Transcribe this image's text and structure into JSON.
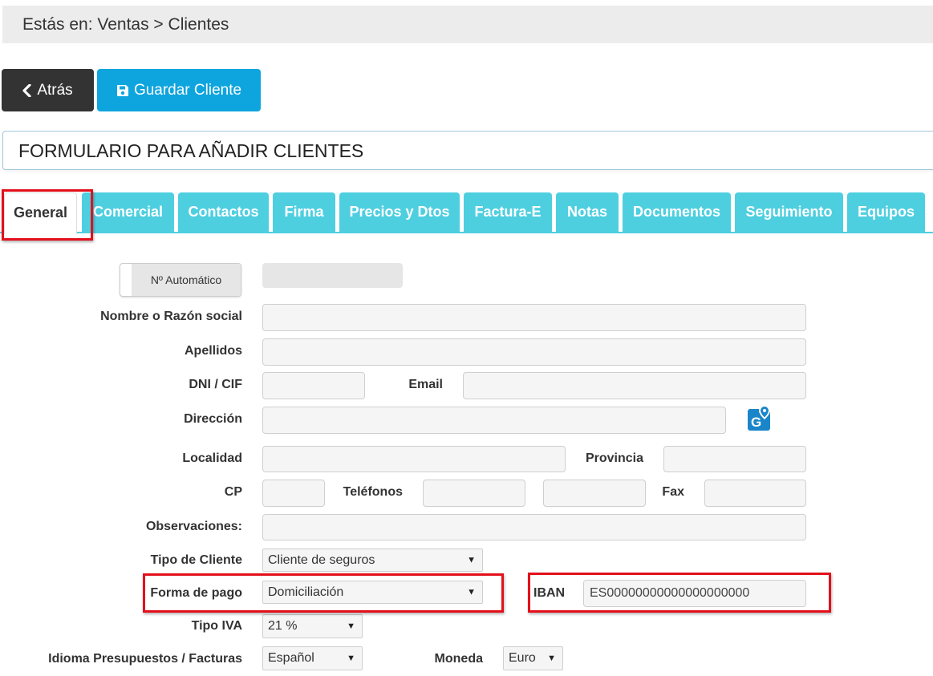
{
  "breadcrumb": {
    "text": "Estás en: Ventas > Clientes"
  },
  "toolbar": {
    "back_label": "Atrás",
    "save_label": "Guardar Cliente"
  },
  "form": {
    "title": "FORMULARIO PARA AÑADIR CLIENTES"
  },
  "tabs": [
    {
      "label": "General",
      "active": true
    },
    {
      "label": "Comercial"
    },
    {
      "label": "Contactos"
    },
    {
      "label": "Firma"
    },
    {
      "label": "Precios y Dtos"
    },
    {
      "label": "Factura-E"
    },
    {
      "label": "Notas"
    },
    {
      "label": "Documentos"
    },
    {
      "label": "Seguimiento"
    },
    {
      "label": "Equipos"
    }
  ],
  "fields": {
    "auto_number_label": "Nº Automático",
    "nombre": {
      "label": "Nombre o Razón social",
      "value": ""
    },
    "apellidos": {
      "label": "Apellidos",
      "value": ""
    },
    "dni": {
      "label": "DNI / CIF",
      "value": ""
    },
    "email": {
      "label": "Email",
      "value": ""
    },
    "direccion": {
      "label": "Dirección",
      "value": ""
    },
    "localidad": {
      "label": "Localidad",
      "value": ""
    },
    "provincia": {
      "label": "Provincia",
      "value": ""
    },
    "cp": {
      "label": "CP",
      "value": ""
    },
    "telefonos": {
      "label": "Teléfonos",
      "value1": "",
      "value2": ""
    },
    "fax": {
      "label": "Fax",
      "value": ""
    },
    "observaciones": {
      "label": "Observaciones:",
      "value": ""
    },
    "tipo_cliente": {
      "label": "Tipo de Cliente",
      "value": "Cliente de seguros"
    },
    "forma_pago": {
      "label": "Forma de pago",
      "value": "Domiciliación"
    },
    "iban": {
      "label": "IBAN",
      "value": "ES00000000000000000000"
    },
    "tipo_iva": {
      "label": "Tipo IVA",
      "value": "21 %"
    },
    "idioma": {
      "label": "Idioma Presupuestos / Facturas",
      "value": "Español"
    },
    "moneda": {
      "label": "Moneda",
      "value": "Euro"
    }
  },
  "icons": {
    "map": "google-maps-icon",
    "back": "chevron-left-icon",
    "save": "floppy-disk-icon"
  },
  "colors": {
    "accent": "#0ea5de",
    "tab": "#4ecfe0",
    "dark_button": "#333333",
    "highlight": "#e3101b"
  }
}
